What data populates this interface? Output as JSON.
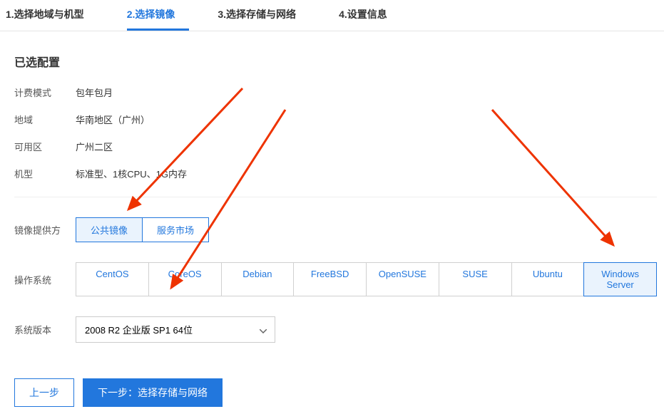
{
  "tabs": {
    "step1": "1.选择地域与机型",
    "step2": "2.选择镜像",
    "step3": "3.选择存储与网络",
    "step4": "4.设置信息"
  },
  "section_title": "已选配置",
  "config": {
    "billing_label": "计费模式",
    "billing_value": "包年包月",
    "region_label": "地域",
    "region_value": "华南地区（广州）",
    "zone_label": "可用区",
    "zone_value": "广州二区",
    "model_label": "机型",
    "model_value": "标准型、1核CPU、1G内存"
  },
  "image_provider": {
    "label": "镜像提供方",
    "public": "公共镜像",
    "market": "服务市场"
  },
  "os": {
    "label": "操作系统",
    "options": [
      "CentOS",
      "CoreOS",
      "Debian",
      "FreeBSD",
      "OpenSUSE",
      "SUSE",
      "Ubuntu",
      "Windows Server"
    ]
  },
  "version": {
    "label": "系统版本",
    "selected": "2008 R2 企业版 SP1 64位"
  },
  "footer": {
    "prev": "上一步",
    "next": "下一步：选择存储与网络"
  }
}
